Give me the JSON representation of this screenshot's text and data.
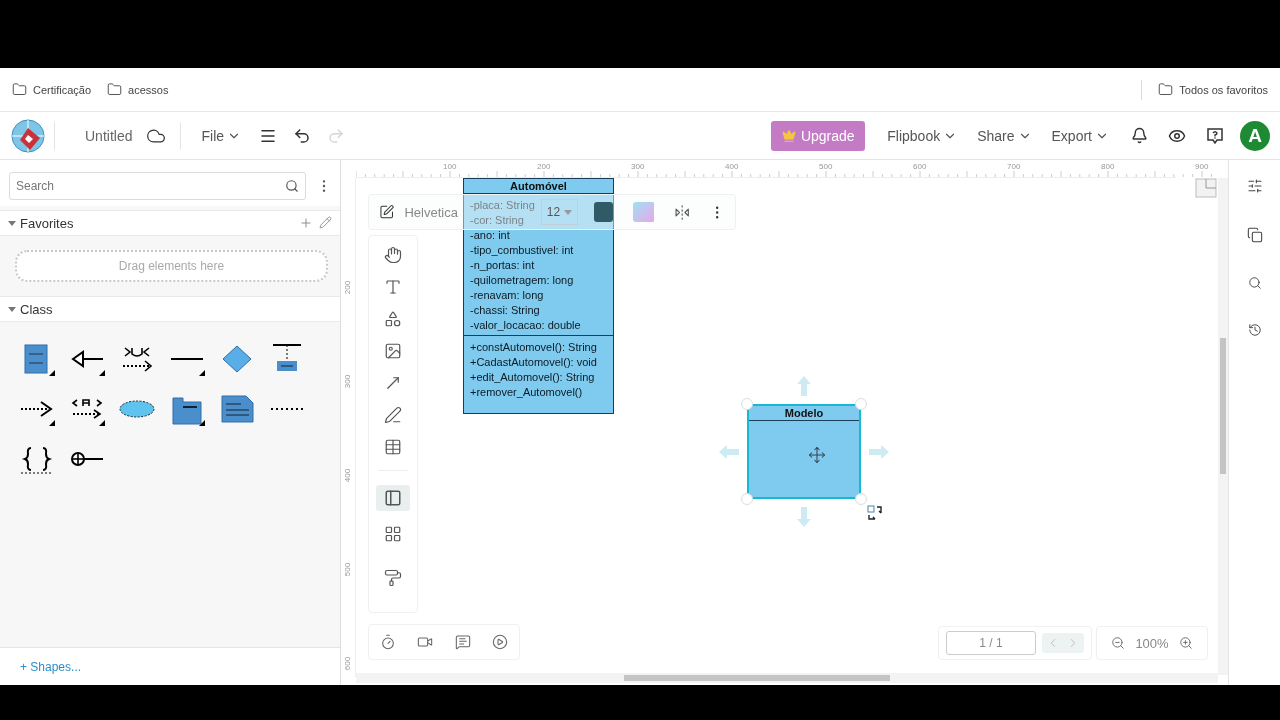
{
  "bookmarks": [
    {
      "label": "Certificação"
    },
    {
      "label": "acessos"
    }
  ],
  "bookmarks_right": {
    "label": "Todos os favoritos"
  },
  "app_bar": {
    "title": "Untitled",
    "file_menu": "File",
    "upgrade": "Upgrade",
    "menus": [
      "Flipbook",
      "Share",
      "Export"
    ],
    "avatar": "A",
    "redo_disabled": true
  },
  "sidebar": {
    "search": {
      "placeholder": "Search"
    },
    "sections": [
      {
        "title": "Favorites",
        "kind": "favorites",
        "expanded": true,
        "dropzone": "Drag elements here"
      },
      {
        "title": "Class",
        "kind": "shapes",
        "expanded": true
      }
    ],
    "more_shapes": "+ Shapes..."
  },
  "ruler": {
    "top_labels": [
      "100",
      "200",
      "300",
      "400",
      "500",
      "600",
      "700",
      "800",
      "900"
    ],
    "left_labels": [
      "200",
      "300",
      "400",
      "500",
      "600"
    ]
  },
  "format_toolbar": {
    "font": "Helvetica",
    "size": "12"
  },
  "shapes": [
    {
      "kind": "class",
      "title": "Automóvel",
      "selected": false,
      "attributes": [
        "-placa: String",
        "-cor: String",
        "-ano: int",
        "-tipo_combustivel: int",
        "-n_portas: int",
        "-quilometragem: long",
        "-renavam: long",
        "-chassi: String",
        "-valor_locacao: double"
      ],
      "methods": [
        "+constAutomovel(): String",
        "+CadastAutomovel(): void",
        "+edit_Automovel(): String",
        "+remover_Automovel()"
      ]
    },
    {
      "kind": "class",
      "title": "Modelo",
      "selected": true
    }
  ],
  "pager": {
    "page": "1 / 1"
  },
  "zoom": "100%"
}
